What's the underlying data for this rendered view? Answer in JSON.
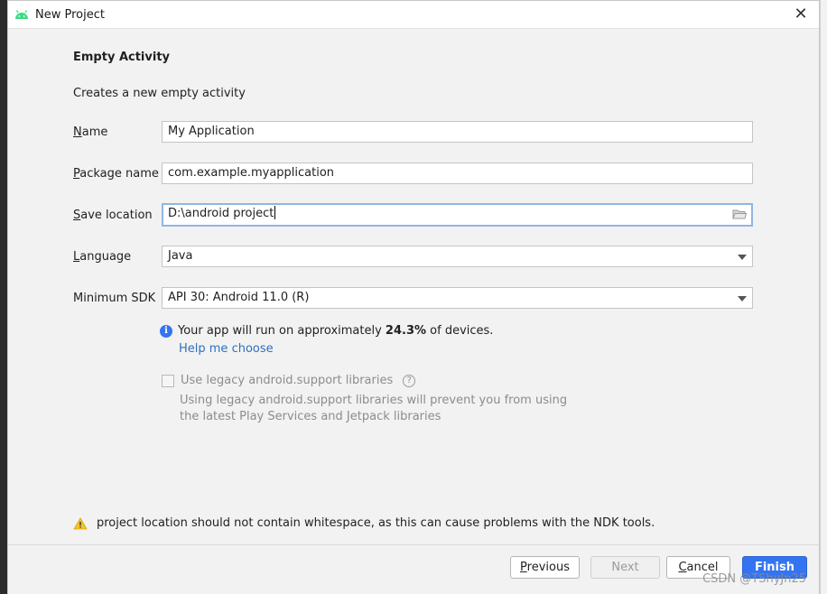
{
  "window": {
    "title": "New Project",
    "close_glyph": "✕"
  },
  "page": {
    "heading": "Empty Activity",
    "subtitle": "Creates a new empty activity"
  },
  "form": {
    "name": {
      "mnemonic": "N",
      "label_rest": "ame",
      "value": "My Application"
    },
    "package": {
      "mnemonic": "P",
      "label_rest": "ackage name",
      "value": "com.example.myapplication"
    },
    "save_location": {
      "mnemonic": "S",
      "label_rest": "ave location",
      "value": "D:\\android project"
    },
    "language": {
      "mnemonic": "L",
      "label_rest": "anguage",
      "value": "Java"
    },
    "min_sdk": {
      "label": "Minimum SDK",
      "value": "API 30: Android 11.0 (R)"
    }
  },
  "info": {
    "icon": "info-icon",
    "prefix": "Your app will run on approximately ",
    "percent": "24.3%",
    "suffix": " of devices.",
    "help_link": "Help me choose"
  },
  "legacy": {
    "checkbox_label": "Use legacy android.support libraries",
    "checked": false,
    "help_glyph": "?",
    "desc_line1": "Using legacy android.support libraries will prevent you from using",
    "desc_line2": "the latest Play Services and Jetpack libraries"
  },
  "warning": {
    "icon": "warning-icon",
    "text": "project location should not contain whitespace, as this can cause problems with the NDK tools."
  },
  "buttons": {
    "previous": {
      "mnemonic": "P",
      "rest": "revious"
    },
    "next": "Next",
    "cancel": {
      "mnemonic": "C",
      "rest": "ancel"
    },
    "finish": "Finish"
  },
  "watermark": "CSDN @TShyJn25",
  "colors": {
    "accent": "#3574f0",
    "link": "#2f6fbd",
    "android_green": "#3ddc84",
    "warning_yellow": "#f2c230"
  }
}
